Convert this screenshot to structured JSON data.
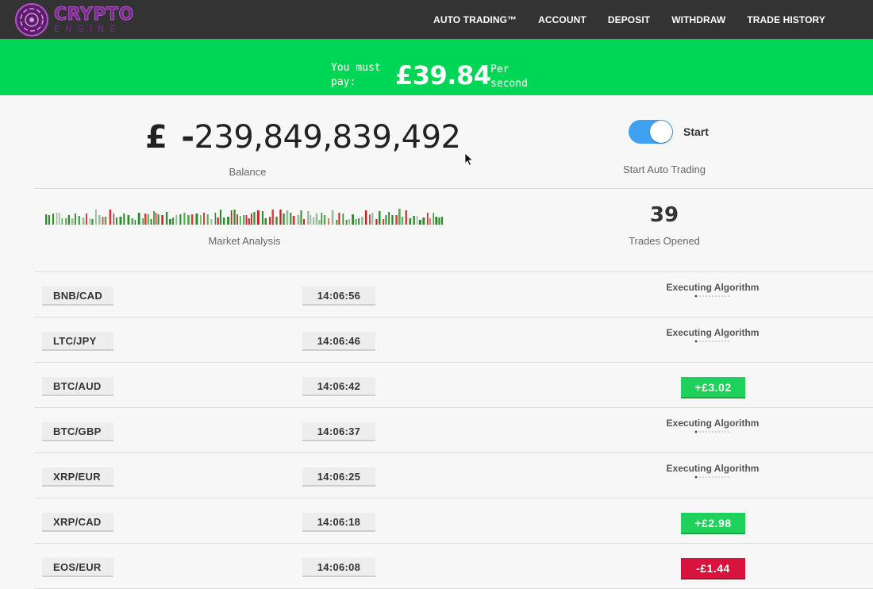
{
  "app": {
    "logo_title": "CRYPTO",
    "logo_subtitle": "ENGINE",
    "brand_color": "#7b2a8e"
  },
  "nav": {
    "items": [
      "AUTO TRADING™",
      "ACCOUNT",
      "DEPOSIT",
      "WITHDRAW",
      "TRADE HISTORY"
    ]
  },
  "banner": {
    "prefix": "You must pay:",
    "amount": "£39.84",
    "suffix": "Per second",
    "color": "#00d655"
  },
  "balance": {
    "currency": "£",
    "sign": "-",
    "value": "239,849,839,492",
    "label": "Balance"
  },
  "auto_trading": {
    "toggle_on": true,
    "toggle_label": "Start",
    "label": "Start Auto Trading",
    "toggle_color": "#3fa2f0"
  },
  "market": {
    "label": "Market Analysis"
  },
  "trades": {
    "count": "39",
    "label": "Trades Opened"
  },
  "trade_rows": [
    {
      "pair": "BNB/CAD",
      "time": "14:06:56",
      "status": "Executing Algorithm",
      "result": "",
      "result_type": "pending"
    },
    {
      "pair": "LTC/JPY",
      "time": "14:06:46",
      "status": "Executing Algorithm",
      "result": "",
      "result_type": "pending"
    },
    {
      "pair": "BTC/AUD",
      "time": "14:06:42",
      "status": "",
      "result": "+£3.02",
      "result_type": "positive"
    },
    {
      "pair": "BTC/GBP",
      "time": "14:06:37",
      "status": "Executing Algorithm",
      "result": "",
      "result_type": "pending"
    },
    {
      "pair": "XRP/EUR",
      "time": "14:06:25",
      "status": "Executing Algorithm",
      "result": "",
      "result_type": "pending"
    },
    {
      "pair": "XRP/CAD",
      "time": "14:06:18",
      "status": "",
      "result": "+£2.98",
      "result_type": "positive"
    },
    {
      "pair": "EOS/EUR",
      "time": "14:06:08",
      "status": "",
      "result": "-£1.44",
      "result_type": "negative"
    }
  ],
  "colors": {
    "positive": "#1ed15b",
    "negative": "#d8133e"
  }
}
